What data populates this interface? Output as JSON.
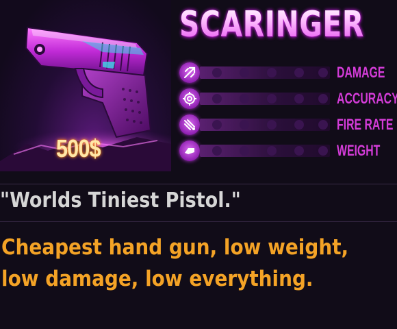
{
  "weapon": {
    "name": "SCARINGER",
    "price": "500$",
    "quote": "\"Worlds Tiniest Pistol.\"",
    "description_lines": [
      "Cheapest hand gun, low weight,",
      " low damage, low everything."
    ]
  },
  "stats": [
    {
      "label": "DAMAGE",
      "icon": "damage-icon",
      "level": 0.0
    },
    {
      "label": "ACCURACY",
      "icon": "crosshair-icon",
      "level": 0.0
    },
    {
      "label": "FIRE RATE",
      "icon": "fire-rate-icon",
      "level": 0.0
    },
    {
      "label": "WEIGHT",
      "icon": "weight-icon",
      "level": 0.0
    }
  ],
  "colors": {
    "background": "#110c18",
    "title": "#ff9cff",
    "stat_label": "#d43cd8",
    "quote": "#d6d6d6",
    "description": "#f4a326",
    "price": "#ffe7a8"
  }
}
